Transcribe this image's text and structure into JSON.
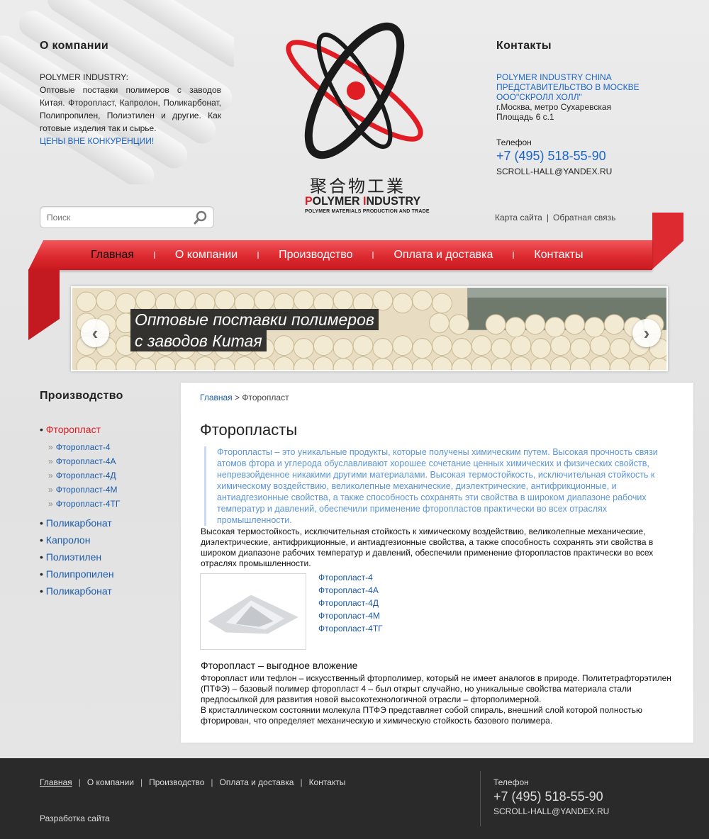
{
  "header": {
    "about": {
      "title": "О компании",
      "company": "POLYMER INDUSTRY:",
      "text": "Оптовые поставки полимеров с заводов Китая. Фторопласт, Капролон, Поликарбонат, Полипропилен, Полиэтилен и другие. Как готовые изделия так и сырье.",
      "highlight": "ЦЕНЫ ВНЕ КОНКУРЕНЦИИ!"
    },
    "logo": {
      "chinese": "聚合物工業",
      "name_p": "P",
      "name_rest1": "OLYMER ",
      "name_i": "I",
      "name_rest2": "NDUSTRY",
      "tagline": "POLYMER MATERIALS PRODUCTION AND TRADE"
    },
    "contacts": {
      "title": "Контакты",
      "org_line1": "POLYMER INDUSTRY CHINA",
      "org_line2": "ПРЕДСТАВИТЕЛЬСТВО В МОСКВЕ",
      "org_line3": "ООО\"СКРОЛЛ ХОЛЛ\"",
      "address1": "г.Москва, метро Сухаревская",
      "address2": "Площадь 6 с.1",
      "phone_label": "Телефон",
      "phone": "+7 (495) 518-55-90",
      "email": "SCROLL-HALL@YANDEX.RU"
    }
  },
  "search": {
    "placeholder": "Поиск"
  },
  "toplinks": {
    "sitemap": "Карта сайта",
    "separator": "|",
    "feedback": "Обратная связь"
  },
  "nav": {
    "items": [
      {
        "label": "Главная"
      },
      {
        "label": "О компании"
      },
      {
        "label": "Производство"
      },
      {
        "label": "Оплата и доставка"
      },
      {
        "label": "Контакты"
      }
    ]
  },
  "slider": {
    "line1": "Оптовые поставки полимеров",
    "line2": "с заводов Китая",
    "prev": "‹",
    "next": "›"
  },
  "sidebar": {
    "title": "Производство",
    "active": "Фторопласт",
    "bullet": "•",
    "sub_marker": "»",
    "sub": [
      "Фторопласт-4",
      "Фторопласт-4А",
      "Фторопласт-4Д",
      "Фторопласт-4М",
      "Фторопласт-4ТГ"
    ],
    "items": [
      "Поликарбонат",
      "Капролон",
      "Полиэтилен",
      "Полипропилен",
      "Поликарбонат"
    ]
  },
  "content": {
    "breadcrumb_home": "Главная",
    "breadcrumb_sep": ">",
    "breadcrumb_current": "Фторопласт",
    "title": "Фторопласты",
    "quote": "Фторопласты – это уникальные продукты, которые получены химическим путем. Высокая прочность связи атомов фтора и углерода обуславливают хорошее сочетание ценных химических и физических свойств, непревзойденное никакими другими материалами. Высокая термостойкость, исключительная стойкость к химическому воздействию, великолепные механические, диэлектрические, антифрикционные, и антиадгезионные свойства, а также способность сохранять эти свойства в широком диапазоне рабочих температур и давлений, обеспечили применение фторопластов практически во всех отраслях промышленности.",
    "paragraph": "Высокая термостойкость, исключительная стойкость к химическому воздействию, великолепные механические, диэлектрические, антифрикционные, и антиадгезионные свойства, а также способность сохранять эти свойства в широком диапазоне рабочих температур и давлений, обеспечили применение фторопластов практически во всех отраслях промышленности.",
    "links": [
      "Фторопласт-4",
      "Фторопласт-4А",
      "Фторопласт-4Д",
      "Фторопласт-4М",
      "Фторопласт-4ТГ"
    ],
    "subtitle": "Фторопласт – выгодное вложение",
    "para2_a": "Фторопласт или тефлон – искусственный фторполимер, который не имеет аналогов в природе. Политетрафторэтилен (ПТФЭ) – базовый полимер фторопласт 4 – был открыт случайно, но уникальные свойства материала стали предпосылкой для развития новой высокотехнологичной отрасли – фторполимерной.",
    "para2_b": "В кристаллическом состоянии молекула ПТФЭ представляет собой спираль, внешний слой которой полностью фторирован, что определяет механическую и химическую стойкость базового полимера."
  },
  "footer": {
    "nav": [
      "Главная",
      "О компании",
      "Производство",
      "Оплата и доставка",
      "Контакты"
    ],
    "separator": "|",
    "dev": "Разработка сайта",
    "phone_label": "Телефон",
    "phone": "+7 (495) 518-55-90",
    "email": "SCROLL-HALL@YANDEX.RU"
  },
  "colors": {
    "accent_red": "#dc2a30",
    "link_blue": "#1a5aa8",
    "quote_blue": "#5b95d6",
    "footer_bg": "#2b2a2b"
  }
}
